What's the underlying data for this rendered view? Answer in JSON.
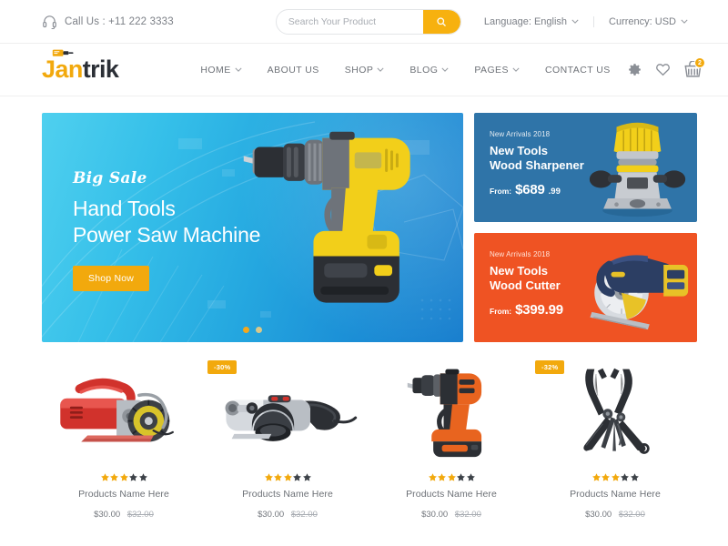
{
  "topbar": {
    "call_icon": "headset-icon",
    "call_text": "Call Us : +11 222 3333",
    "search": {
      "placeholder": "Search Your Product",
      "value": "",
      "button_icon": "search-icon"
    },
    "language": {
      "label": "Language: English",
      "caret": "chevron-down-icon"
    },
    "currency": {
      "label": "Currency: USD",
      "caret": "chevron-down-icon"
    }
  },
  "header": {
    "logo": {
      "part1": "Jan",
      "part2": "trik",
      "icon": "drill-logo-icon"
    },
    "nav": [
      {
        "label": "HOME",
        "caret": true
      },
      {
        "label": "ABOUT US",
        "caret": false
      },
      {
        "label": "SHOP",
        "caret": true
      },
      {
        "label": "BLOG",
        "caret": true
      },
      {
        "label": "PAGES",
        "caret": true
      },
      {
        "label": "CONTACT US",
        "caret": false
      }
    ],
    "icons": {
      "settings": "gear-icon",
      "wishlist": "heart-icon",
      "cart": "cart-icon",
      "cart_count": "2"
    }
  },
  "hero": {
    "tagline": "Big Sale",
    "title_line1": "Hand Tools",
    "title_line2": "Power Saw Machine",
    "cta": "Shop Now",
    "product_image": "cordless-drill-yellow",
    "dots": [
      "active",
      "semi"
    ],
    "colors": {
      "from": "#4fd0ef",
      "to": "#1a7fce",
      "accent": "#f2a90d"
    }
  },
  "promos": [
    {
      "subtitle": "New Arrivals 2018",
      "title_line1": "New Tools",
      "title_line2": "Wood Sharpener",
      "from_label": "From:",
      "price_main": "$689",
      "price_cents": ".99",
      "bg": "#2f74a8",
      "image": "wood-router-yellow"
    },
    {
      "subtitle": "New Arrivals 2018",
      "title_line1": "New Tools",
      "title_line2": "Wood Cutter",
      "from_label": "From:",
      "price_main": "$399.99",
      "price_cents": "",
      "bg": "#ef5323",
      "image": "circular-saw-blue"
    }
  ],
  "products": [
    {
      "badge": "",
      "image": "red-concrete-cutter",
      "rating_filled": 3,
      "rating_total": 5,
      "name": "Products Name Here",
      "price": "$30.00",
      "old_price": "$32.00"
    },
    {
      "badge": "-30%",
      "image": "grey-angle-grinder",
      "rating_filled": 3,
      "rating_total": 5,
      "name": "Products Name Here",
      "price": "$30.00",
      "old_price": "$32.00"
    },
    {
      "badge": "",
      "image": "orange-cordless-drill",
      "rating_filled": 3,
      "rating_total": 5,
      "name": "Products Name Here",
      "price": "$30.00",
      "old_price": "$32.00"
    },
    {
      "badge": "-32%",
      "image": "black-multi-tool",
      "rating_filled": 3,
      "rating_total": 5,
      "name": "Products Name Here",
      "price": "$30.00",
      "old_price": "$32.00"
    }
  ]
}
